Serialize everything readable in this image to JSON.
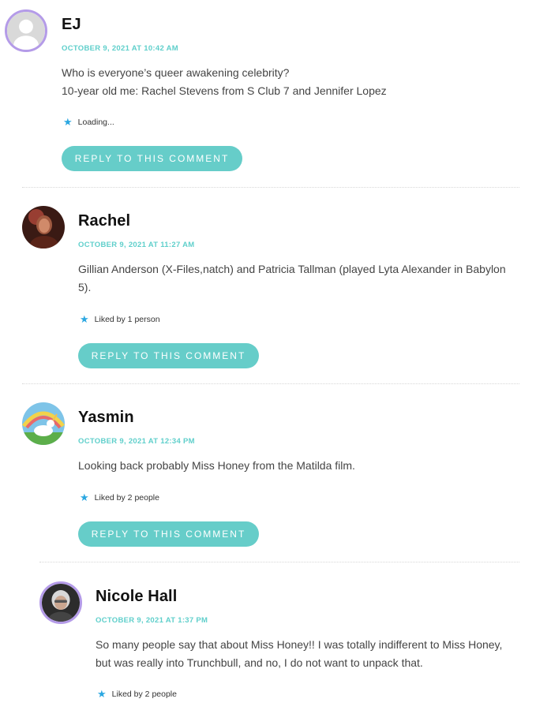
{
  "comments": [
    {
      "author": "EJ",
      "date": "OCTOBER 9, 2021 AT 10:42 AM",
      "text_lines": [
        "Who is everyone’s queer awakening celebrity?",
        "10-year old me: Rachel Stevens from S Club 7 and Jennifer Lopez"
      ],
      "like": "Loading...",
      "reply_label": "REPLY TO THIS COMMENT"
    },
    {
      "author": "Rachel",
      "date": "OCTOBER 9, 2021 AT 11:27 AM",
      "text_lines": [
        "Gillian Anderson (X-Files,natch) and Patricia Tallman (played Lyta Alexander in Babylon",
        "5)."
      ],
      "like": "Liked by 1 person",
      "reply_label": "REPLY TO THIS COMMENT"
    },
    {
      "author": "Yasmin",
      "date": "OCTOBER 9, 2021 AT 12:34 PM",
      "text_lines": [
        "Looking back probably Miss Honey from the Matilda film."
      ],
      "like": "Liked by 2 people",
      "reply_label": "REPLY TO THIS COMMENT"
    },
    {
      "author": "Nicole Hall",
      "date": "OCTOBER 9, 2021 AT 1:37 PM",
      "text_lines": [
        "So many people say that about Miss Honey!! I was totally indifferent to Miss Honey,",
        "but was really into Trunchbull, and no, I do not want to unpack that."
      ],
      "like": "Liked by 2 people"
    }
  ],
  "colors": {
    "accent": "#66cdc9",
    "date": "#5fcfcb",
    "star": "#2ba7e1",
    "avatar_ring": "#b49be8"
  },
  "icons": {
    "like": "star-icon"
  }
}
